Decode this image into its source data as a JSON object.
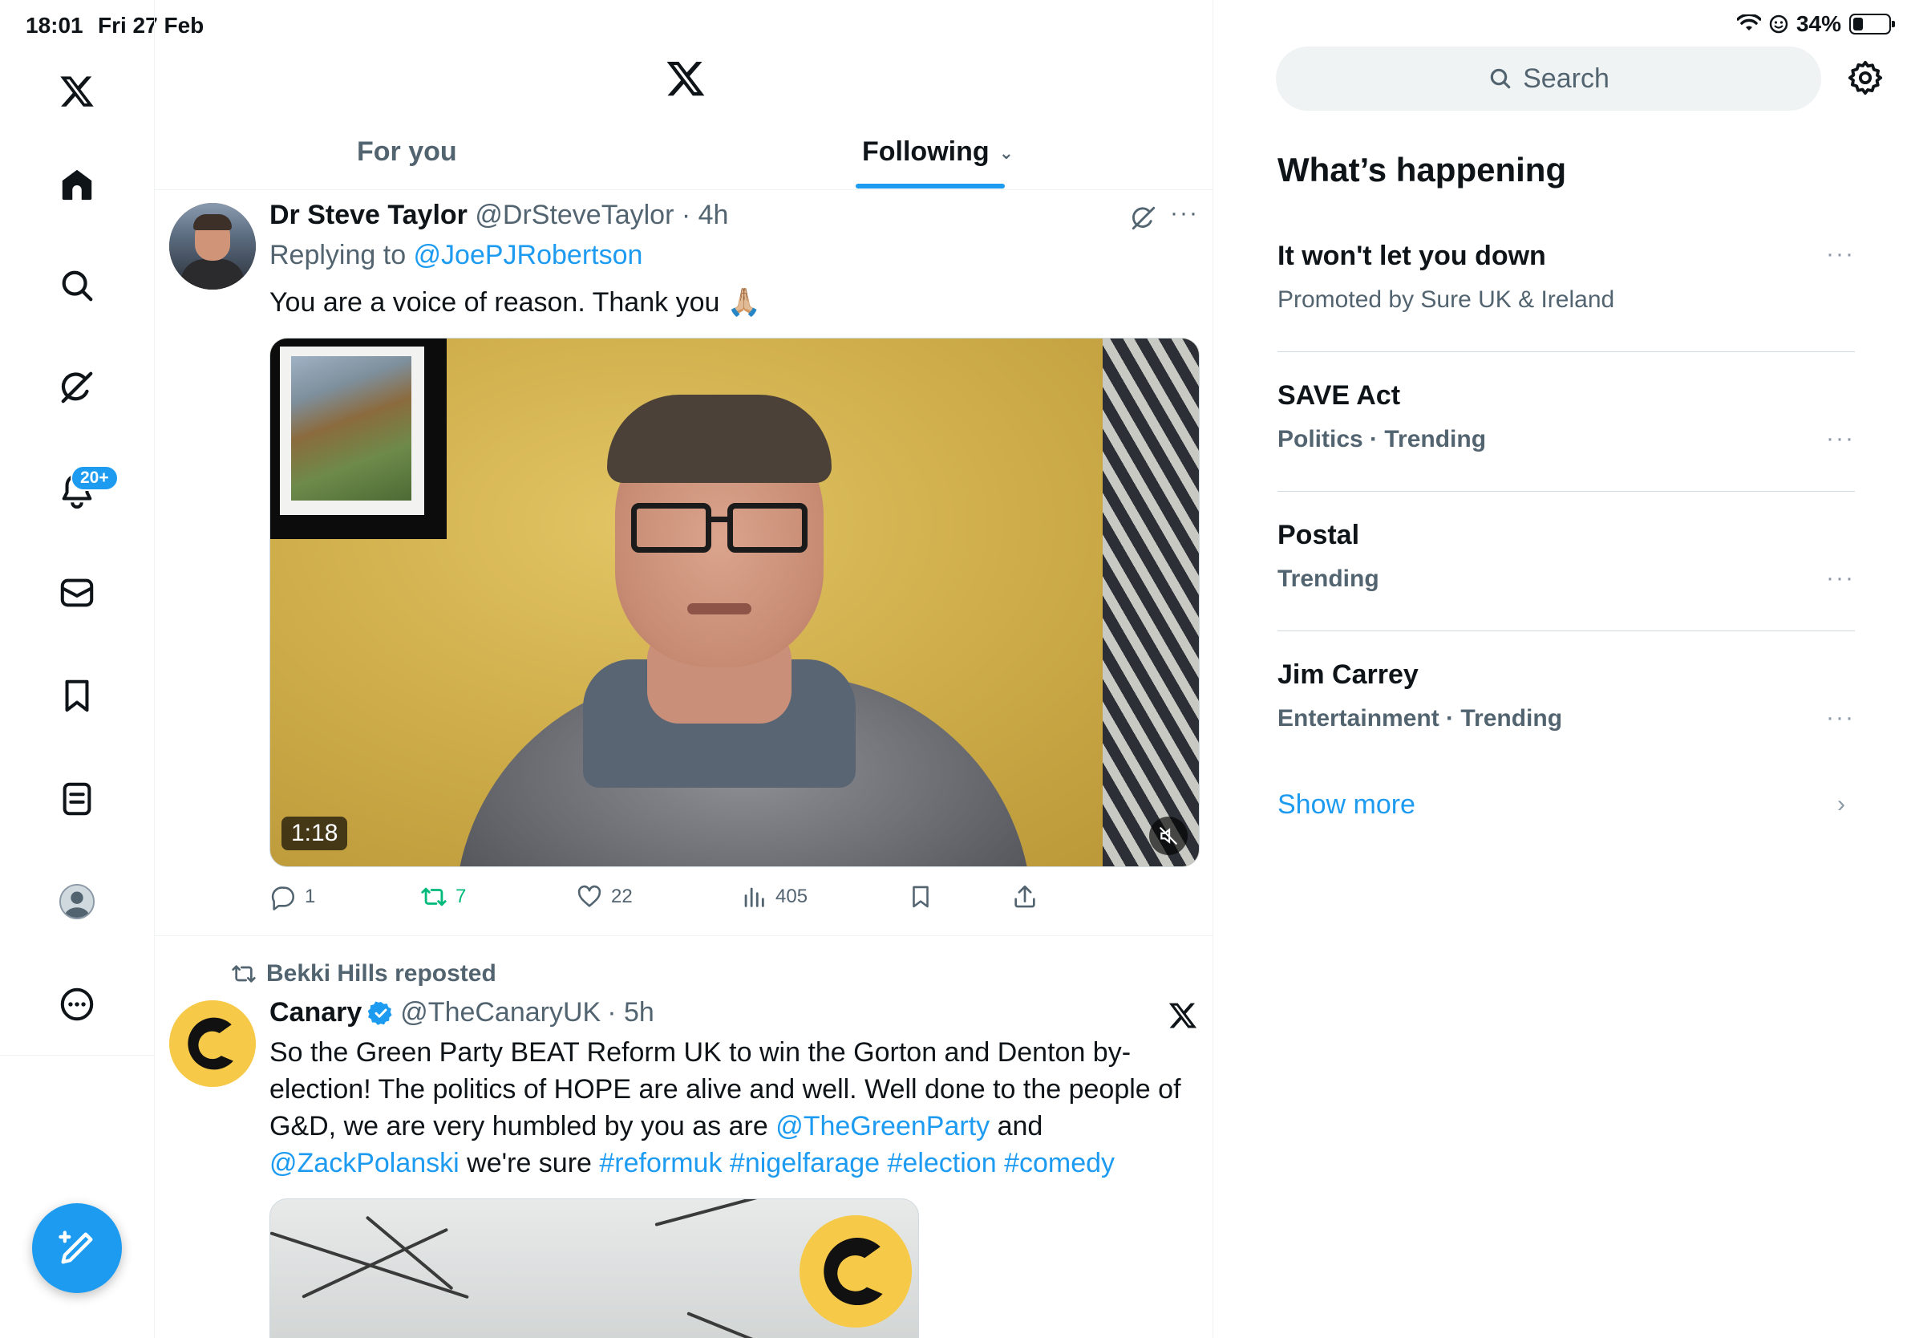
{
  "status_bar": {
    "time": "18:01",
    "date": "Fri 27 Feb",
    "battery": "34%"
  },
  "nav": {
    "notifications_badge": "20+",
    "items": [
      "x-logo",
      "home",
      "search",
      "grok",
      "notifications",
      "messages",
      "bookmarks",
      "lists",
      "profile",
      "more"
    ]
  },
  "tabs": {
    "for_you": "For you",
    "following": "Following"
  },
  "tweet1": {
    "name": "Dr Steve Taylor",
    "handle": "@DrSteveTaylor",
    "time": "· 4h",
    "replying_prefix": "Replying to ",
    "replying_to": "@JoePJRobertson",
    "text": "You are a voice of reason. Thank you 🙏🏼",
    "video_duration": "1:18",
    "replies": "1",
    "reposts": "7",
    "likes": "22",
    "views": "405"
  },
  "tweet2": {
    "reposted_by": "Bekki Hills reposted",
    "name": "Canary",
    "handle": "@TheCanaryUK",
    "time": "· 5h",
    "text_1": "So the Green Party BEAT Reform UK to win the Gorton and Denton by-election! The politics of HOPE are alive and well. Well done to the people of G&D, we are very humbled by you as are ",
    "mention_1": "@TheGreenParty",
    "text_2": " and ",
    "mention_2": "@ZackPolanski",
    "text_3": " we're sure ",
    "hashtag_1": "#reformuk",
    "hashtag_2": "#nigelfarage",
    "hashtag_3": "#election",
    "hashtag_4": "#comedy"
  },
  "right": {
    "search_placeholder": "Search",
    "whats_happening": "What’s happening",
    "trends": [
      {
        "title": "It won't let you down",
        "sub": "Promoted by Sure UK & Ireland"
      },
      {
        "title": "SAVE Act",
        "sub": "Politics · Trending"
      },
      {
        "title": "Postal",
        "sub": "Trending"
      },
      {
        "title": "Jim Carrey",
        "sub": "Entertainment · Trending"
      }
    ],
    "show_more": "Show more"
  },
  "colors": {
    "accent": "#1d9bf0",
    "repost_green": "#00ba7c",
    "text_secondary": "#536471"
  }
}
